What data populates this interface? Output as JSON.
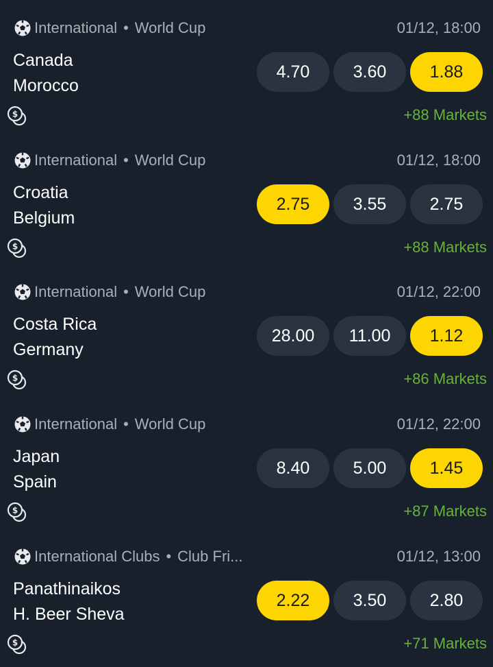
{
  "matches": [
    {
      "category": "International",
      "league": "World Cup",
      "time": "01/12, 18:00",
      "home": "Canada",
      "away": "Morocco",
      "odds": [
        "4.70",
        "3.60",
        "1.88"
      ],
      "selected_index": 2,
      "markets": "+88 Markets"
    },
    {
      "category": "International",
      "league": "World Cup",
      "time": "01/12, 18:00",
      "home": "Croatia",
      "away": "Belgium",
      "odds": [
        "2.75",
        "3.55",
        "2.75"
      ],
      "selected_index": 0,
      "markets": "+88 Markets"
    },
    {
      "category": "International",
      "league": "World Cup",
      "time": "01/12, 22:00",
      "home": "Costa Rica",
      "away": "Germany",
      "odds": [
        "28.00",
        "11.00",
        "1.12"
      ],
      "selected_index": 2,
      "markets": "+86 Markets"
    },
    {
      "category": "International",
      "league": "World Cup",
      "time": "01/12, 22:00",
      "home": "Japan",
      "away": "Spain",
      "odds": [
        "8.40",
        "5.00",
        "1.45"
      ],
      "selected_index": 2,
      "markets": "+87 Markets"
    },
    {
      "category": "International Clubs",
      "league": "Club Fri...",
      "time": "01/12, 13:00",
      "home": "Panathinaikos",
      "away": "H. Beer Sheva",
      "odds": [
        "2.22",
        "3.50",
        "2.80"
      ],
      "selected_index": 0,
      "markets": "+71 Markets"
    }
  ],
  "icons": {
    "sport": "soccer-ball-icon",
    "cashout": "cashout-coin-icon"
  },
  "colors": {
    "background": "#18202b",
    "odd_button": "#2a3440",
    "selected_odd": "#fdd500",
    "markets_link": "#67b33a",
    "meta_text": "#a9b0b8"
  }
}
